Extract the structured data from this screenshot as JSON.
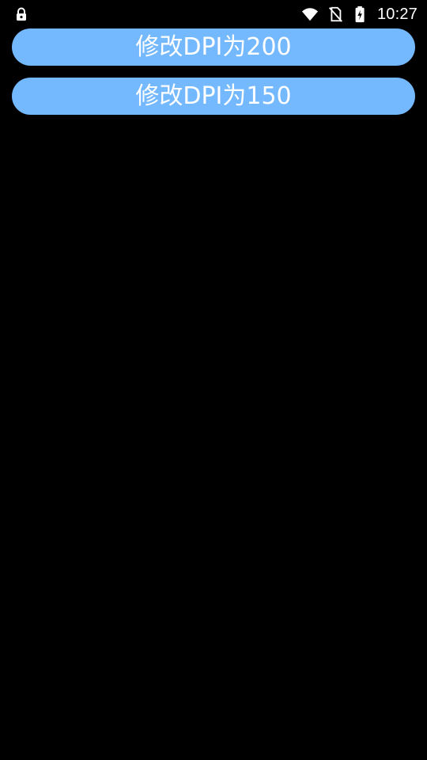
{
  "status_bar": {
    "time": "10:27",
    "icons": [
      "lock-icon",
      "wifi-icon",
      "no-sim-icon",
      "battery-charging-icon"
    ],
    "color": "#ffffff"
  },
  "buttons": [
    {
      "label": "修改DPI为200"
    },
    {
      "label": "修改DPI为150"
    }
  ],
  "colors": {
    "background": "#000000",
    "button_bg": "#74b8fe",
    "button_text": "#ffffff"
  }
}
